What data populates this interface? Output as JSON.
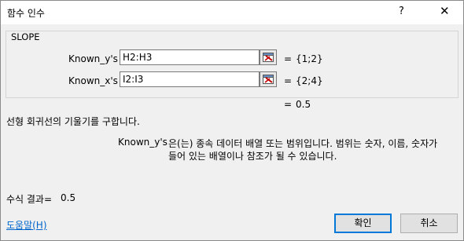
{
  "window": {
    "title": "함수 인수",
    "help_label": "?",
    "close_label": "✕"
  },
  "function": {
    "name": "SLOPE",
    "args": [
      {
        "label": "Known_y's",
        "value": "H2:H3",
        "result": "{1;2}"
      },
      {
        "label": "Known_x's",
        "value": "I2:I3",
        "result": "{2;4}"
      }
    ],
    "result": "0.5",
    "eq": "="
  },
  "description": {
    "main": "선형 회귀선의 기울기를 구합니다.",
    "arg_name": "Known_y's",
    "arg_line1": "은(는) 종속 데이터 배열 또는 범위입니다. 범위는 숫자, 이름, 숫자가",
    "arg_line2": "들어 있는 배열이나 참조가 될 수 있습니다."
  },
  "formula_result": {
    "label": "수식 결과=",
    "value": "0.5"
  },
  "buttons": {
    "help_link": "도움말(H)",
    "ok": "확인",
    "cancel": "취소"
  },
  "icons": {
    "ref": "range-select-icon"
  }
}
